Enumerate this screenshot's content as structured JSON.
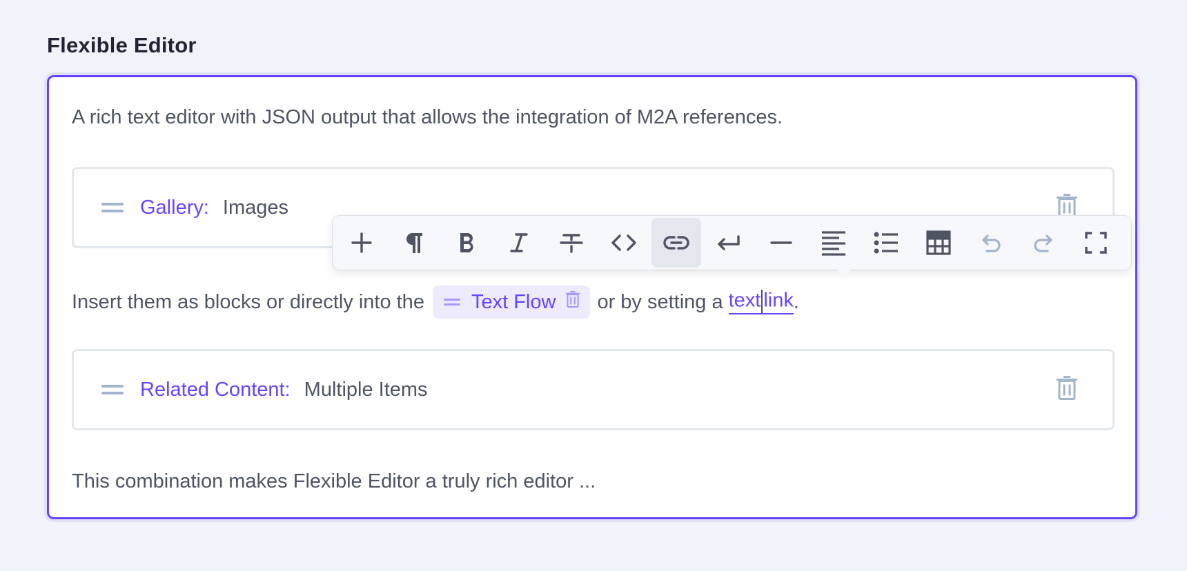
{
  "field": {
    "label": "Flexible Editor"
  },
  "content": {
    "intro": "A rich text editor with JSON output that allows the integration of M2A references.",
    "blocks": [
      {
        "type": "Gallery:",
        "value": "Images"
      },
      {
        "type": "Related Content:",
        "value": "Multiple Items"
      }
    ],
    "inline_para": {
      "before": "Insert them as blocks or directly into the",
      "chip_label": "Text Flow",
      "middle": "or by setting a",
      "link_part1": "text",
      "link_part2": "link",
      "after": "."
    },
    "closing": "This combination makes Flexible Editor a truly rich editor ..."
  },
  "toolbar": {
    "buttons": [
      {
        "name": "insert-block",
        "icon": "plus-icon",
        "active": false,
        "disabled": false
      },
      {
        "name": "paragraph",
        "icon": "pilcrow-icon",
        "active": false,
        "disabled": false
      },
      {
        "name": "bold",
        "icon": "bold-icon",
        "active": false,
        "disabled": false
      },
      {
        "name": "italic",
        "icon": "italic-icon",
        "active": false,
        "disabled": false
      },
      {
        "name": "strikethrough",
        "icon": "strikethrough-icon",
        "active": false,
        "disabled": false
      },
      {
        "name": "code",
        "icon": "code-icon",
        "active": false,
        "disabled": false
      },
      {
        "name": "link",
        "icon": "link-icon",
        "active": true,
        "disabled": false
      },
      {
        "name": "hard-break",
        "icon": "return-icon",
        "active": false,
        "disabled": false
      },
      {
        "name": "horizontal-rule",
        "icon": "horizontal-rule-icon",
        "active": false,
        "disabled": false
      },
      {
        "name": "text-align",
        "icon": "align-left-icon",
        "active": false,
        "disabled": false
      },
      {
        "name": "bullet-list",
        "icon": "bullet-list-icon",
        "active": false,
        "disabled": false
      },
      {
        "name": "table",
        "icon": "table-icon",
        "active": false,
        "disabled": false
      },
      {
        "name": "undo",
        "icon": "undo-icon",
        "active": false,
        "disabled": true
      },
      {
        "name": "redo",
        "icon": "redo-icon",
        "active": false,
        "disabled": true
      },
      {
        "name": "fullscreen",
        "icon": "fullscreen-icon",
        "active": false,
        "disabled": false
      }
    ]
  },
  "colors": {
    "accent": "#6644ff",
    "text": "#4f5464",
    "icon": "#4f5464",
    "icon_disabled": "#a2b5cd",
    "trash": "#a2b5cd",
    "background": "#f0f3f9"
  }
}
